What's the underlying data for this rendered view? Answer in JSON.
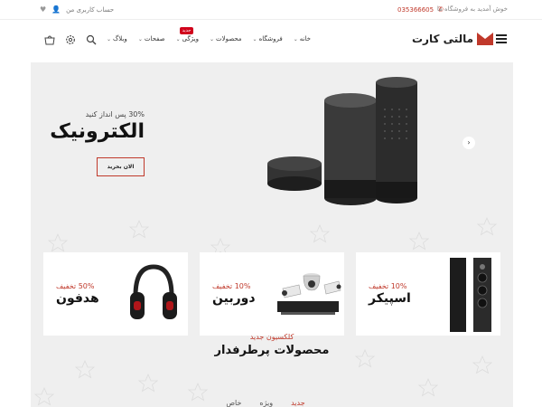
{
  "topbar": {
    "welcome": "خوش آمدید به فروشگاه ما",
    "phone": "035366605",
    "account": "حساب کاربری من",
    "icons": [
      "heart-icon",
      "user-icon",
      "phone-icon"
    ]
  },
  "header": {
    "logo_text": "مالتی کارت",
    "nav": [
      {
        "label": "خانه",
        "has_dropdown": true
      },
      {
        "label": "فروشگاه",
        "has_dropdown": true
      },
      {
        "label": "محصولات",
        "has_dropdown": true
      },
      {
        "label": "ویژگی",
        "has_dropdown": true,
        "badge": "جدید"
      },
      {
        "label": "صفحات",
        "has_dropdown": true
      },
      {
        "label": "وبلاگ",
        "has_dropdown": true
      }
    ],
    "icons": [
      "basket-icon",
      "gear-icon",
      "search-icon"
    ]
  },
  "hero": {
    "subtitle": "30% پس انداز کنید",
    "title": "الکترونیک",
    "button": "الان بخرید",
    "arrow": "›"
  },
  "cards": [
    {
      "discount": "10% تخفیف",
      "name": "اسپیکر"
    },
    {
      "discount": "10% تخفیف",
      "name": "دوربین"
    },
    {
      "discount": "50% تخفیف",
      "name": "هدفون"
    }
  ],
  "collection": {
    "subtitle": "کلکسیون جدید",
    "title": "محصولات پرطرفدار",
    "tabs": [
      "جدید",
      "ویژه",
      "خاص"
    ]
  },
  "colors": {
    "accent": "#c0392b",
    "badge": "#d0021b",
    "background": "#efefef"
  }
}
